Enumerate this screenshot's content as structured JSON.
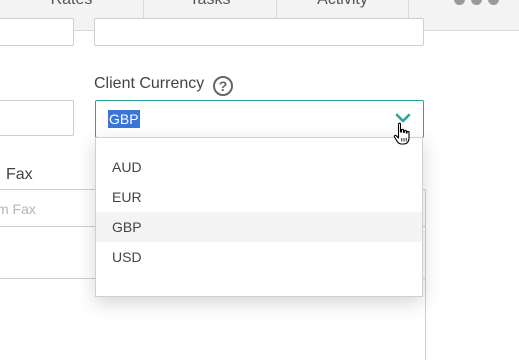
{
  "tabs": {
    "rates": "Rates",
    "tasks": "Tasks",
    "activity": "Activity"
  },
  "form": {
    "fax_label": "Fax",
    "fax_placeholder": "m Fax",
    "client_currency_label": "Client Currency",
    "help_glyph": "?"
  },
  "currency_select": {
    "selected": "GBP",
    "options": [
      "AUD",
      "EUR",
      "GBP",
      "USD"
    ],
    "highlighted": "GBP"
  },
  "colors": {
    "accent": "#26a69a",
    "selection": "#3a76d8",
    "option_highlight": "#f4f4f4"
  },
  "icons": {
    "help": "question-circle-icon",
    "more": "more-horizontal-icon",
    "chevron": "chevron-down-icon",
    "cursor": "hand-pointer-icon"
  }
}
